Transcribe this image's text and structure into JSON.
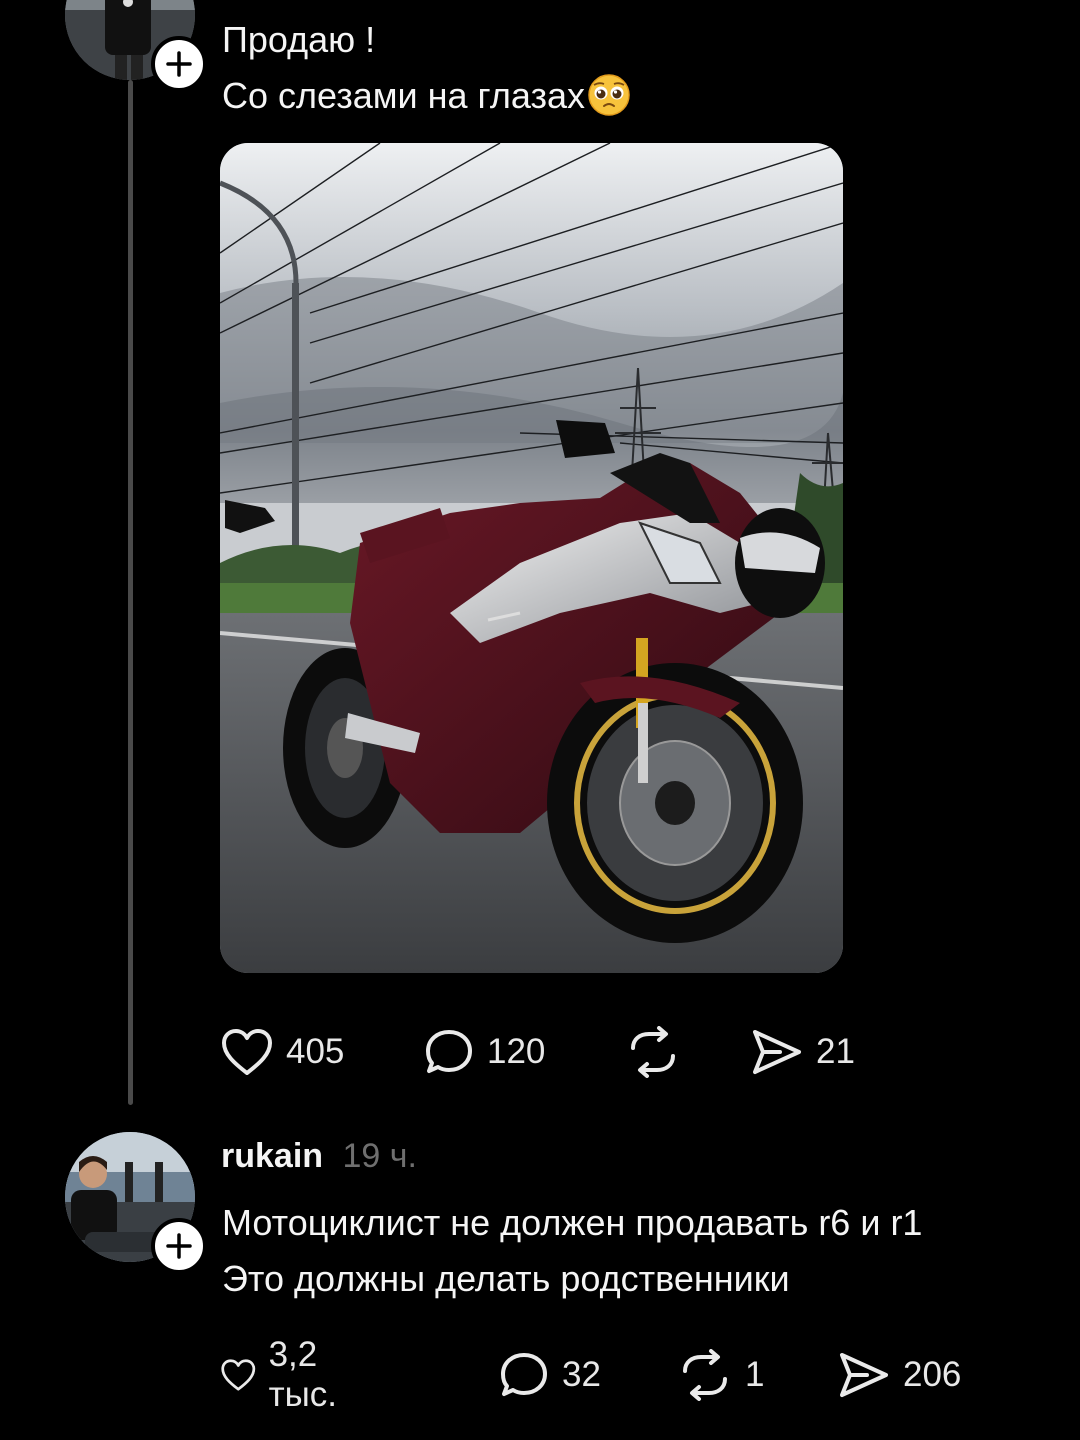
{
  "post": {
    "text_lines": [
      "Продаю !",
      "Со слезами на глазах"
    ],
    "emoji": "pleading-face",
    "likes": "405",
    "comments": "120",
    "shares": "21"
  },
  "reply": {
    "username": "rukain",
    "time": "19 ч.",
    "text_lines": [
      "Мотоциклист не должен продавать r6 и r1",
      "Это должны делать родственники"
    ],
    "likes": "3,2 тыс.",
    "comments": "32",
    "reposts": "1",
    "shares": "206"
  },
  "colors": {
    "background": "#000000",
    "text": "#f5f5f5",
    "muted": "#6f6f6f",
    "thread_line": "#4a4a4a"
  },
  "icons": [
    "heart-icon",
    "comment-icon",
    "repost-icon",
    "share-icon",
    "plus-icon"
  ]
}
